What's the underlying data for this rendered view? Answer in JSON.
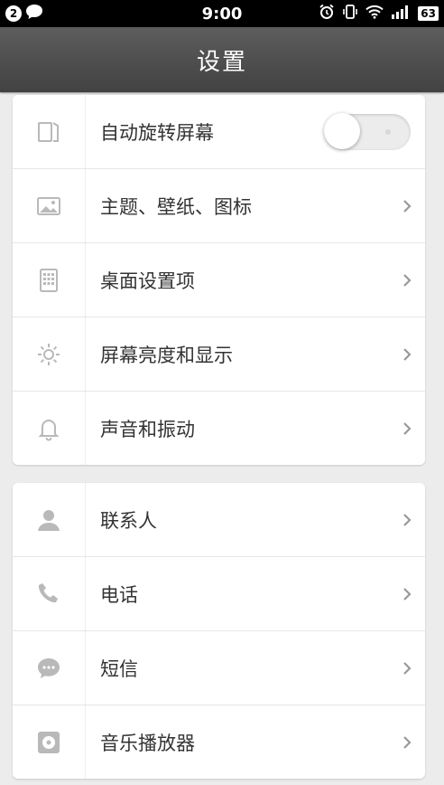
{
  "status_bar": {
    "notification_count": "2",
    "time": "9:00",
    "battery": "63"
  },
  "header": {
    "title": "设置"
  },
  "groups": [
    {
      "items": [
        {
          "label": "自动旋转屏幕",
          "icon": "auto-rotate-icon",
          "control": "toggle",
          "on": false
        },
        {
          "label": "主题、壁纸、图标",
          "icon": "image-icon",
          "control": "chevron"
        },
        {
          "label": "桌面设置项",
          "icon": "grid-icon",
          "control": "chevron"
        },
        {
          "label": "屏幕亮度和显示",
          "icon": "brightness-icon",
          "control": "chevron"
        },
        {
          "label": "声音和振动",
          "icon": "bell-icon",
          "control": "chevron"
        }
      ]
    },
    {
      "items": [
        {
          "label": "联系人",
          "icon": "person-icon",
          "control": "chevron"
        },
        {
          "label": "电话",
          "icon": "phone-icon",
          "control": "chevron"
        },
        {
          "label": "短信",
          "icon": "message-icon",
          "control": "chevron"
        },
        {
          "label": "音乐播放器",
          "icon": "music-player-icon",
          "control": "chevron"
        }
      ]
    }
  ],
  "colors": {
    "status_bar_bg": "#000000",
    "header_bg": "#4f4f4f",
    "page_bg": "#ececec",
    "icon_gray": "#b9b9b9",
    "chevron_gray": "#999999"
  }
}
